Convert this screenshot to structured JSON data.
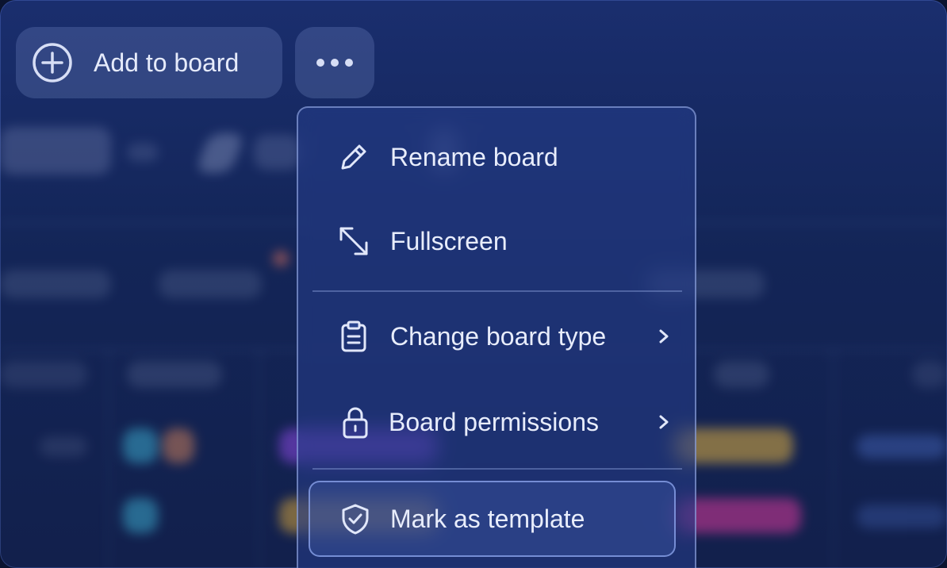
{
  "toolbar": {
    "add_label": "Add to board",
    "add_icon": "plus-circle-icon",
    "more_icon": "more-horizontal-icon"
  },
  "menu": {
    "items": [
      {
        "label": "Rename board",
        "icon": "pencil-icon",
        "submenu": false
      },
      {
        "label": "Fullscreen",
        "icon": "expand-diagonal-icon",
        "submenu": false
      },
      {
        "label": "Change board type",
        "icon": "clipboard-icon",
        "submenu": true
      },
      {
        "label": "Board permissions",
        "icon": "lock-icon",
        "submenu": true
      },
      {
        "label": "Mark as template",
        "icon": "shield-check-icon",
        "submenu": false,
        "highlighted": true
      }
    ]
  },
  "colors": {
    "background": "#132557",
    "text": "#e8edfc",
    "menu_border": "#aabef5"
  }
}
